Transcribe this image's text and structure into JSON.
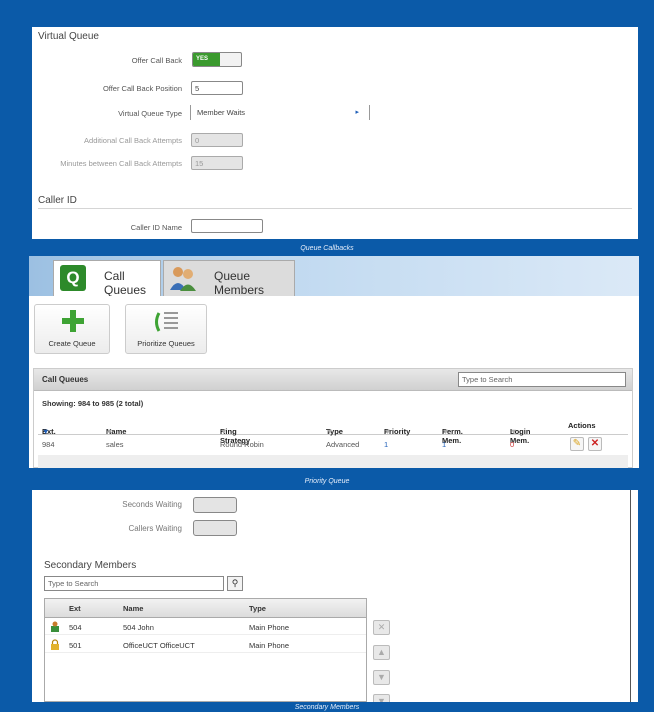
{
  "panel1": {
    "title": "Virtual Queue",
    "rows": [
      {
        "label": "Offer Call Back",
        "toggle_on": "YES"
      },
      {
        "label": "Offer Call Back Position",
        "value": "5"
      },
      {
        "label": "Virtual Queue Type",
        "value": "Member Waits"
      },
      {
        "label": "Additional Call Back Attempts",
        "value": "0"
      },
      {
        "label": "Minutes between Call Back Attempts",
        "value": "15"
      }
    ],
    "caller_title": "Caller ID",
    "caller_label": "Caller ID Name",
    "caller_value": ""
  },
  "caption1": "Queue Callbacks",
  "panel2": {
    "tabs": [
      {
        "label": "Call Queues",
        "icon": "queue-q-icon"
      },
      {
        "label": "Queue Members",
        "icon": "members-icon"
      }
    ],
    "buttons": {
      "create": "Create Queue",
      "prioritize": "Prioritize Queues"
    },
    "grid_title": "Call Queues",
    "search_placeholder": "Type to Search",
    "showing": "Showing: 984 to 985 (2 total)",
    "columns": [
      "Ext.",
      "Name",
      "Ring Strategy",
      "Type",
      "Priority",
      "Perm. Mem.",
      "Login Mem.",
      "Actions"
    ],
    "rows": [
      {
        "ext": "984",
        "name": "sales",
        "strategy": "Round Robin",
        "type": "Advanced",
        "priority": "1",
        "perm": "1",
        "login": "0"
      }
    ]
  },
  "caption2": "Priority Queue",
  "panel3": {
    "seconds_label": "Seconds Waiting",
    "callers_label": "Callers Waiting",
    "section_title": "Secondary Members",
    "search_placeholder": "Type to Search",
    "columns": [
      "Ext",
      "Name",
      "Type"
    ],
    "rows": [
      {
        "ext": "504",
        "name": "504 John",
        "type": "Main Phone",
        "icon": "phone-user-icon"
      },
      {
        "ext": "501",
        "name": "OfficeUCT OfficeUCT",
        "type": "Main Phone",
        "icon": "lock-icon"
      }
    ]
  },
  "caption3": "Secondary Members",
  "colors": {
    "background": "#0b5aa8",
    "toggle_on": "#3b9a2e",
    "accent_blue": "#1f5fb8",
    "delete_red": "#cc3333"
  }
}
